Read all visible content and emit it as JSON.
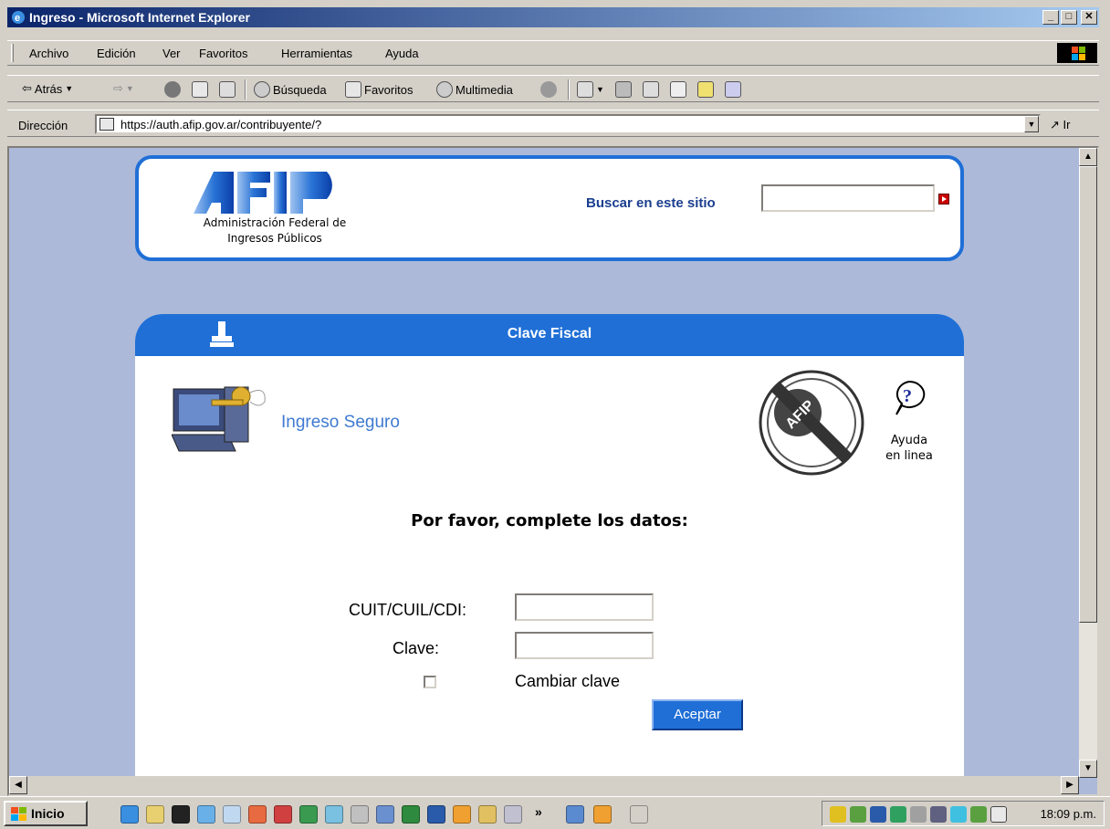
{
  "window": {
    "title": "Ingreso - Microsoft Internet Explorer",
    "minimize": "_",
    "maximize": "□",
    "close": "✕"
  },
  "menubar": {
    "items": [
      "Archivo",
      "Edición",
      "Ver",
      "Favoritos",
      "Herramientas",
      "Ayuda"
    ]
  },
  "toolbar": {
    "back": "Atrás",
    "search": "Búsqueda",
    "favorites": "Favoritos",
    "multimedia": "Multimedia"
  },
  "addressbar": {
    "label": "Dirección",
    "url": "https://auth.afip.gov.ar/contribuyente/?",
    "go": "Ir"
  },
  "header": {
    "org_name_line1": "Administración Federal de",
    "org_name_line2": "Ingresos Públicos",
    "search_label": "Buscar en este sitio",
    "search_value": ""
  },
  "panel": {
    "title": "Clave Fiscal",
    "ingreso_seguro": "Ingreso Seguro",
    "help_line1": "Ayuda",
    "help_line2": "en linea",
    "form_title": "Por favor, complete los datos:",
    "cuit_label": "CUIT/CUIL/CDI:",
    "cuit_value": "",
    "clave_label": "Clave:",
    "clave_value": "",
    "cambiar_label": "Cambiar clave",
    "aceptar_label": "Aceptar"
  },
  "taskbar": {
    "start_label": "Inicio",
    "clock": "18:09 p.m.",
    "chevron": "»"
  },
  "colors": {
    "accent_blue": "#1f6fd6",
    "page_bg": "#adb9d9",
    "link_blue": "#3f7ad1"
  }
}
